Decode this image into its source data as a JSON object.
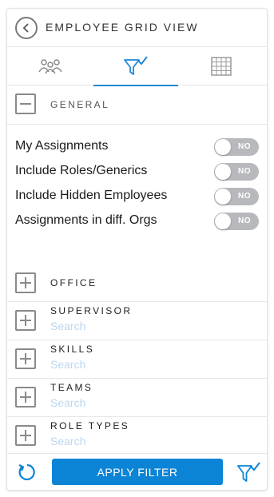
{
  "header": {
    "title": "EMPLOYEE GRID VIEW",
    "back_icon": "chevron-left-circle-icon"
  },
  "tabs": [
    {
      "icon": "people-icon",
      "active": false
    },
    {
      "icon": "filter-check-icon",
      "active": true
    },
    {
      "icon": "grid-icon",
      "active": false
    }
  ],
  "general": {
    "label": "GENERAL",
    "toggles": [
      {
        "label": "My Assignments",
        "state": "NO"
      },
      {
        "label": "Include Roles/Generics",
        "state": "NO"
      },
      {
        "label": "Include Hidden Employees",
        "state": "NO"
      },
      {
        "label": "Assignments in diff. Orgs",
        "state": "NO"
      }
    ]
  },
  "sections": [
    {
      "label": "OFFICE"
    },
    {
      "label": "SUPERVISOR",
      "placeholder": "Search"
    },
    {
      "label": "SKILLS",
      "placeholder": "Search"
    },
    {
      "label": "TEAMS",
      "placeholder": "Search"
    },
    {
      "label": "ROLE TYPES",
      "placeholder": "Search"
    }
  ],
  "footer": {
    "apply_label": "APPLY FILTER"
  },
  "colors": {
    "accent": "#0b84d6",
    "toggle_off": "#b7b9bd",
    "placeholder": "#bcd6ef",
    "icon_gray": "#8a8a8a"
  }
}
